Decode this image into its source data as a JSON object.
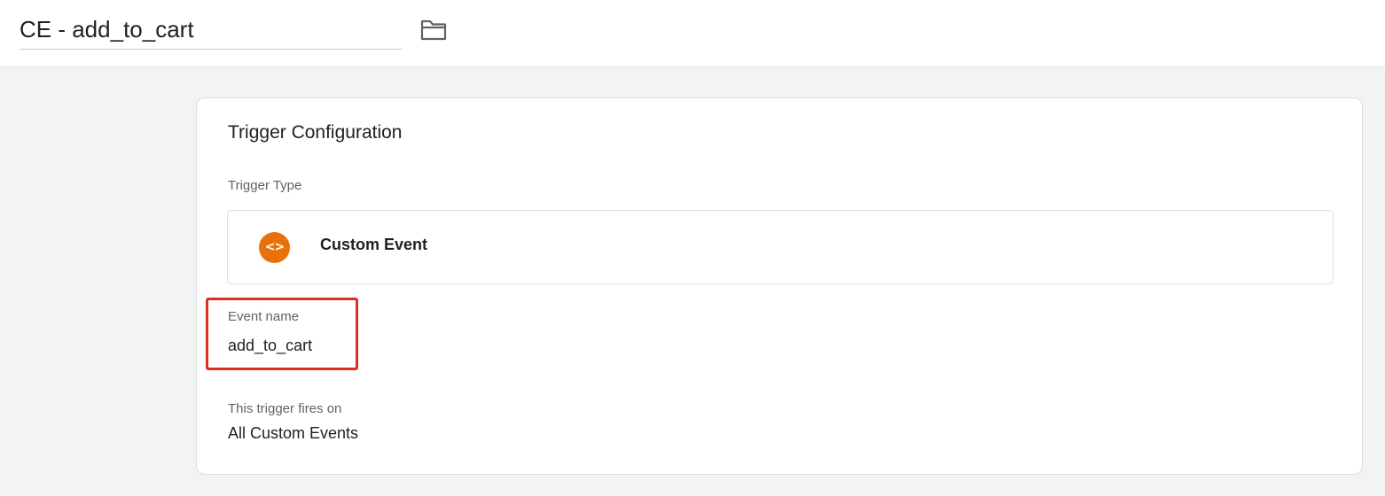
{
  "header": {
    "title": "CE - add_to_cart",
    "folder_icon": "folder-icon"
  },
  "trigger_config": {
    "title": "Trigger Configuration",
    "trigger_type_label": "Trigger Type",
    "trigger_type": {
      "icon": "code-brackets-icon",
      "icon_glyph": "<>",
      "icon_color": "#e8710a",
      "name": "Custom Event"
    },
    "event_name_label": "Event name",
    "event_name_value": "add_to_cart",
    "highlight_color": "#d93025",
    "fires_on_label": "This trigger fires on",
    "fires_on_value": "All Custom Events"
  }
}
